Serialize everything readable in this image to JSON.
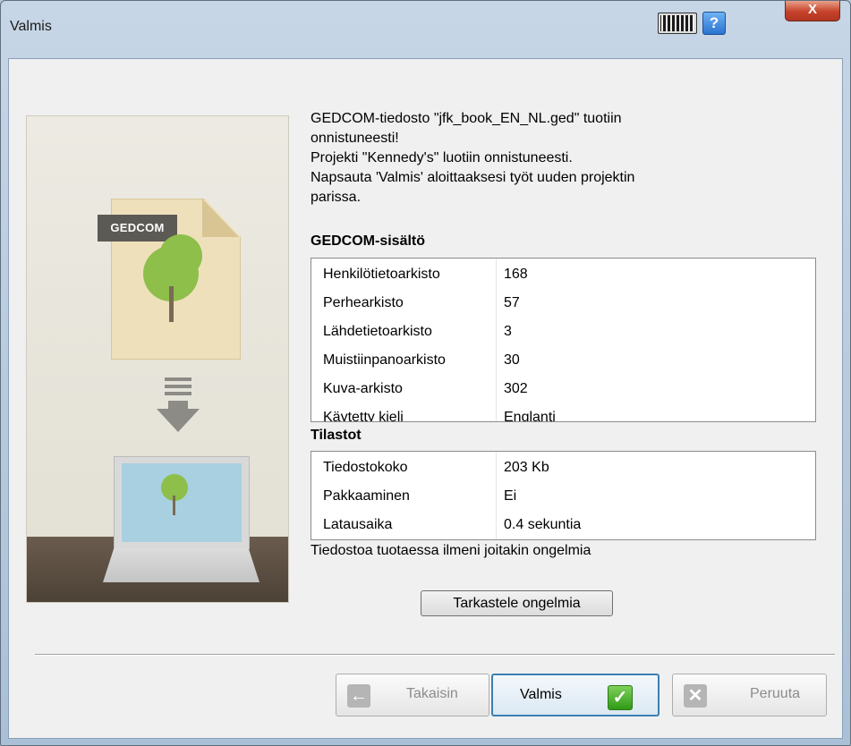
{
  "window": {
    "title": "Valmis",
    "close_glyph": "X",
    "help_glyph": "?"
  },
  "illustration": {
    "file_label": "GEDCOM"
  },
  "message": {
    "line1": "GEDCOM-tiedosto \"jfk_book_EN_NL.ged\" tuotiin",
    "line2": "onnistuneesti!",
    "line3": "Projekti \"Kennedy's\" luotiin onnistuneesti.",
    "line4": "Napsauta 'Valmis' aloittaaksesi työt uuden projektin",
    "line5": "parissa."
  },
  "gedcom_contents": {
    "title": "GEDCOM-sisältö",
    "rows": [
      {
        "key": "Henkilötietoarkisto",
        "value": "168"
      },
      {
        "key": "Perhearkisto",
        "value": "57"
      },
      {
        "key": "Lähdetietoarkisto",
        "value": "3"
      },
      {
        "key": "Muistiinpanoarkisto",
        "value": "30"
      },
      {
        "key": "Kuva-arkisto",
        "value": "302"
      },
      {
        "key": "Käytetty kieli",
        "value": "Englanti"
      }
    ]
  },
  "statistics": {
    "title": "Tilastot",
    "rows": [
      {
        "key": "Tiedostokoko",
        "value": "203 Kb"
      },
      {
        "key": "Pakkaaminen",
        "value": "Ei"
      },
      {
        "key": "Latausaika",
        "value": "0.4 sekuntia"
      }
    ]
  },
  "warning": "Tiedostoa tuotaessa ilmeni joitakin ongelmia",
  "view_problems_button": "Tarkastele ongelmia",
  "nav": {
    "back": {
      "label": "Takaisin",
      "icon": "arrow-left-icon",
      "enabled": false
    },
    "finish": {
      "label": "Valmis",
      "icon": "checkmark-icon",
      "enabled": true
    },
    "cancel": {
      "label": "Peruuta",
      "icon": "x-icon",
      "enabled": false
    }
  }
}
